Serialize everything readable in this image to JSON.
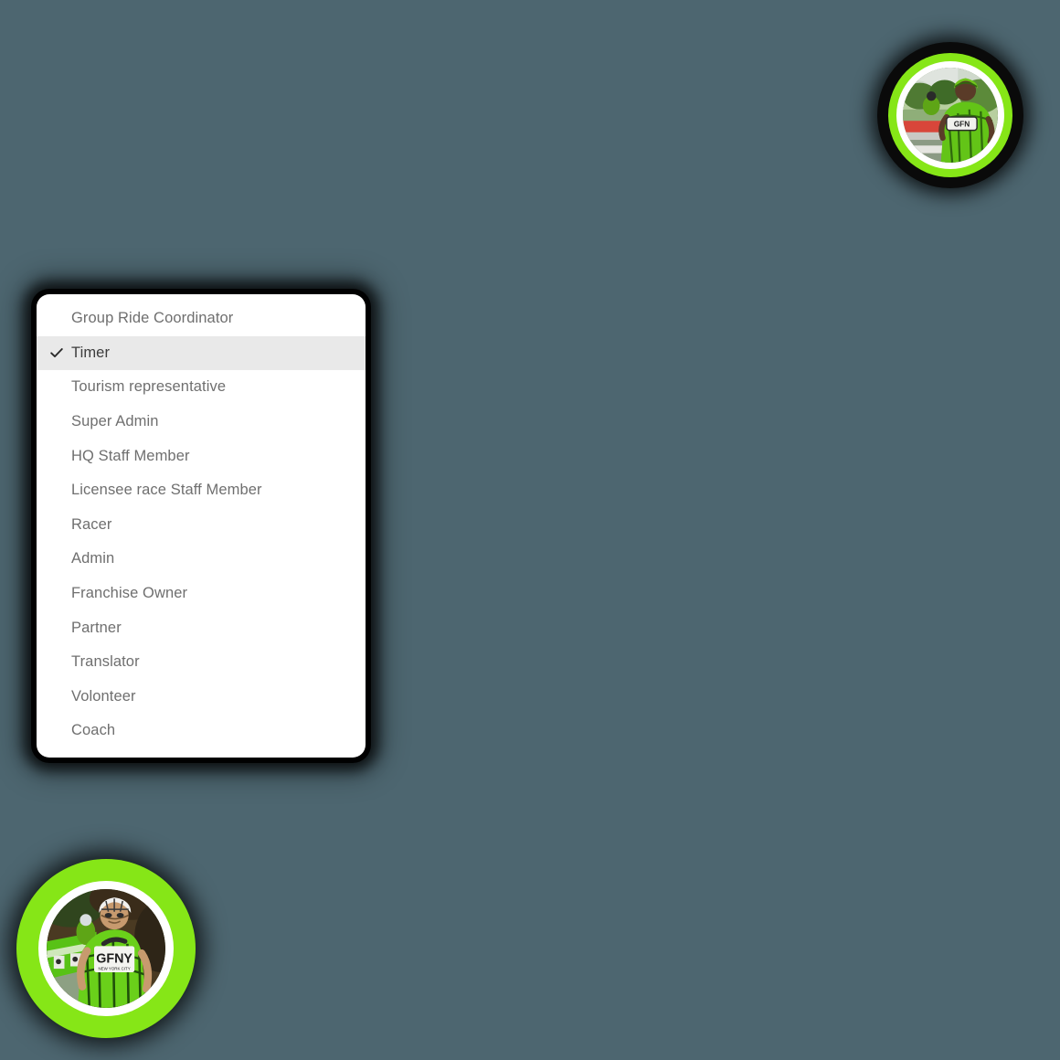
{
  "theme": {
    "background_color": "#4d6670",
    "panel_background": "#ffffff",
    "selected_row_background": "#e9e9e9",
    "item_text_color": "#6f6f6f",
    "accent_green": "#86e617",
    "ring_black": "#0a0a0a",
    "ring_white": "#ffffff"
  },
  "dropdown": {
    "name": "role-selector-dropdown",
    "selected_value": "Timer",
    "check_icon": "check-icon",
    "items": [
      {
        "label": "Group Ride Coordinator",
        "selected": false
      },
      {
        "label": "Timer",
        "selected": true
      },
      {
        "label": "Tourism representative",
        "selected": false
      },
      {
        "label": "Super Admin",
        "selected": false
      },
      {
        "label": "HQ Staff Member",
        "selected": false
      },
      {
        "label": "Licensee race Staff Member",
        "selected": false
      },
      {
        "label": "Racer",
        "selected": false
      },
      {
        "label": "Admin",
        "selected": false
      },
      {
        "label": "Franchise Owner",
        "selected": false
      },
      {
        "label": "Partner",
        "selected": false
      },
      {
        "label": "Translator",
        "selected": false
      },
      {
        "label": "Volonteer",
        "selected": false
      },
      {
        "label": "Coach",
        "selected": false
      }
    ]
  },
  "avatars": [
    {
      "name": "avatar-top-right",
      "icon": "user-avatar-photo",
      "description": "cyclist in green GFNY jersey",
      "jersey_text": "GFNY"
    },
    {
      "name": "avatar-bottom-left",
      "icon": "user-avatar-photo",
      "description": "cyclist with helmet in green GFNY jersey",
      "jersey_text": "GFNY",
      "jersey_subtext": "NEW YORK CITY"
    }
  ]
}
